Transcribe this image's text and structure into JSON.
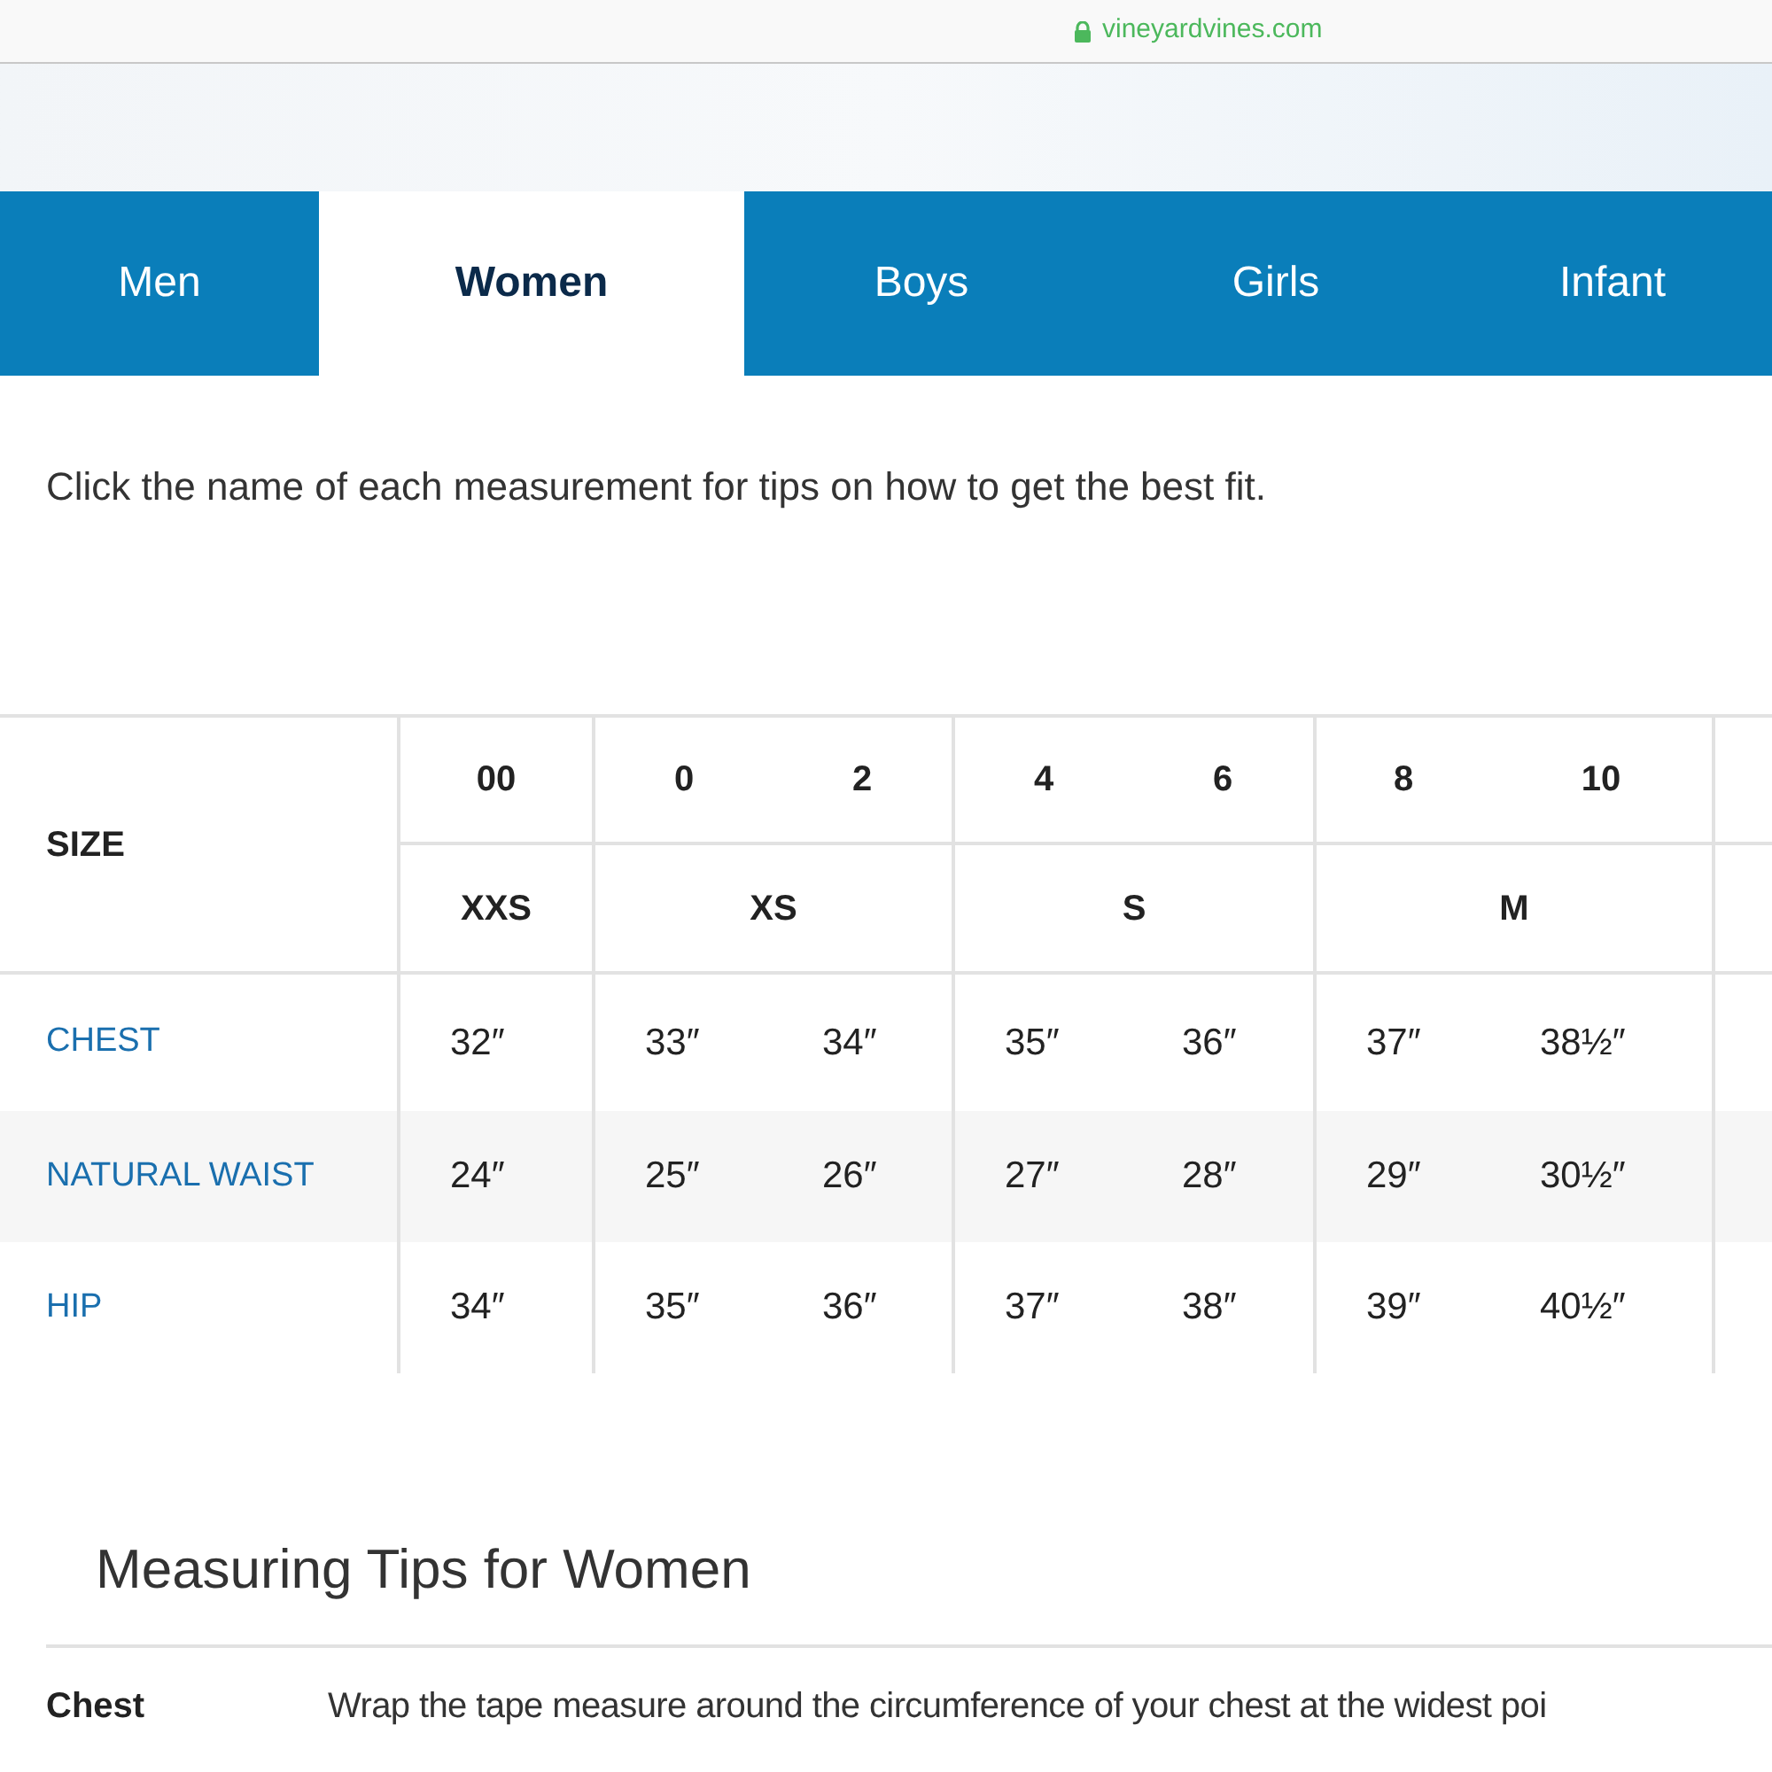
{
  "address_bar": {
    "url": "vineyardvines.com"
  },
  "tabs": [
    {
      "label": "Men",
      "selected": false
    },
    {
      "label": "Women",
      "selected": true
    },
    {
      "label": "Boys",
      "selected": false
    },
    {
      "label": "Girls",
      "selected": false
    },
    {
      "label": "Infant",
      "selected": false
    }
  ],
  "instruction": "Click the name of each measurement for tips on how to get the best fit.",
  "size_table": {
    "header_label": "SIZE",
    "groups": [
      {
        "letter": "XXS",
        "numbers": [
          "00"
        ]
      },
      {
        "letter": "XS",
        "numbers": [
          "0",
          "2"
        ]
      },
      {
        "letter": "S",
        "numbers": [
          "4",
          "6"
        ]
      },
      {
        "letter": "M",
        "numbers": [
          "8",
          "10"
        ]
      }
    ],
    "rows": [
      {
        "name": "CHEST",
        "values": [
          "32″",
          "33″",
          "34″",
          "35″",
          "36″",
          "37″",
          "38½″"
        ]
      },
      {
        "name": "NATURAL WAIST",
        "values": [
          "24″",
          "25″",
          "26″",
          "27″",
          "28″",
          "29″",
          "30½″"
        ]
      },
      {
        "name": "HIP",
        "values": [
          "34″",
          "35″",
          "36″",
          "37″",
          "38″",
          "39″",
          "40½″"
        ]
      }
    ]
  },
  "measuring_tips": {
    "title": "Measuring Tips for Women",
    "items": [
      {
        "term": "Chest",
        "text": "Wrap the tape measure around the circumference of your chest at the widest poi"
      }
    ]
  }
}
